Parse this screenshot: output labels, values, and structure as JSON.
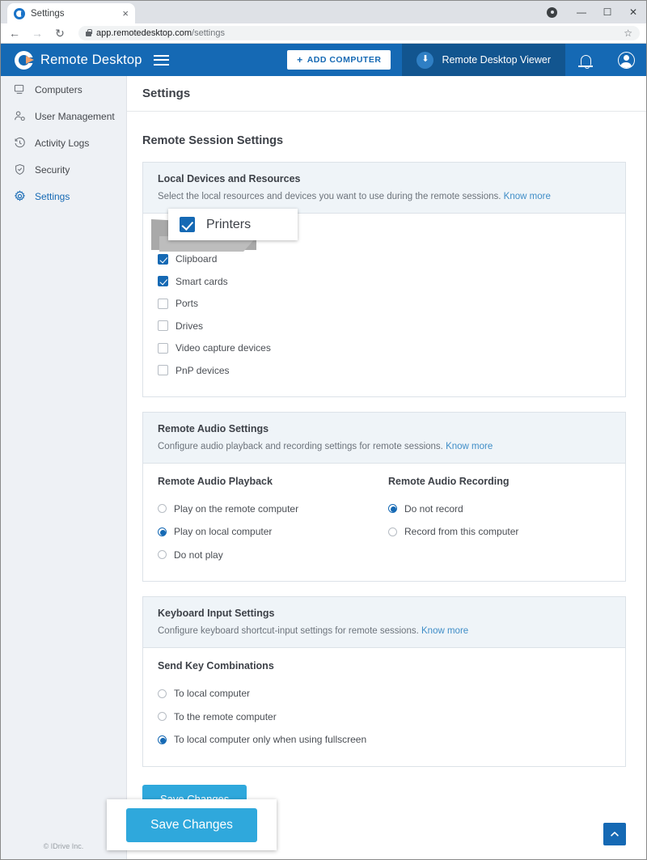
{
  "browser": {
    "tab_title": "Settings",
    "tab_favicon": "remote-desktop-favicon",
    "tab_close": "×",
    "back_icon": "←",
    "forward_icon": "→",
    "reload_icon": "↻",
    "url_host": "app.remotedesktop.com",
    "url_path": "/settings",
    "bookmark_icon": "☆",
    "minimize": "—",
    "maximize": "☐",
    "close": "✕"
  },
  "header": {
    "brand": "Remote Desktop",
    "menu_icon": "hamburger-icon",
    "add_computer": "ADD COMPUTER",
    "add_computer_plus": "+",
    "viewer": "Remote Desktop Viewer",
    "viewer_icon": "download-circle-icon",
    "notifications_icon": "bell-icon",
    "account_icon": "user-avatar-icon",
    "accent": "#1569b4",
    "accent_dark": "#12558f"
  },
  "sidebar": {
    "items": [
      {
        "label": "Computers",
        "icon": "monitor-icon",
        "active": false
      },
      {
        "label": "User Management",
        "icon": "user-gear-icon",
        "active": false
      },
      {
        "label": "Activity Logs",
        "icon": "clock-history-icon",
        "active": false
      },
      {
        "label": "Security",
        "icon": "shield-check-icon",
        "active": false
      },
      {
        "label": "Settings",
        "icon": "gear-icon",
        "active": true
      }
    ],
    "footer": "© IDrive Inc."
  },
  "page": {
    "title": "Settings",
    "section_title": "Remote Session Settings"
  },
  "local_devices": {
    "title": "Local Devices and Resources",
    "description": "Select the local resources and devices you want to use during the remote sessions.",
    "link": "Know more",
    "options": [
      {
        "label": "Printers",
        "checked": true
      },
      {
        "label": "Clipboard",
        "checked": true
      },
      {
        "label": "Smart cards",
        "checked": true
      },
      {
        "label": "Ports",
        "checked": false
      },
      {
        "label": "Drives",
        "checked": false
      },
      {
        "label": "Video capture devices",
        "checked": false
      },
      {
        "label": "PnP devices",
        "checked": false
      }
    ]
  },
  "audio": {
    "title": "Remote Audio Settings",
    "description": "Configure audio playback and recording settings for remote sessions.",
    "link": "Know more",
    "playback": {
      "title": "Remote Audio Playback",
      "options": [
        {
          "label": "Play on the remote computer",
          "selected": false
        },
        {
          "label": "Play on local computer",
          "selected": true
        },
        {
          "label": "Do not play",
          "selected": false
        }
      ]
    },
    "recording": {
      "title": "Remote Audio Recording",
      "options": [
        {
          "label": "Do not record",
          "selected": true
        },
        {
          "label": "Record from this computer",
          "selected": false
        }
      ]
    }
  },
  "keyboard": {
    "title": "Keyboard Input Settings",
    "description": "Configure keyboard shortcut-input settings for remote sessions.",
    "link": "Know more",
    "group_title": "Send Key Combinations",
    "options": [
      {
        "label": "To local computer",
        "selected": false
      },
      {
        "label": "To the remote computer",
        "selected": false
      },
      {
        "label": "To local computer only when using fullscreen",
        "selected": true
      }
    ]
  },
  "actions": {
    "save": "Save Changes",
    "save_color": "#2fa8dc",
    "scroll_top_icon": "chevron-up-icon"
  },
  "callouts": {
    "printers_zoom_label": "Printers",
    "save_zoom_label": "Save Changes"
  }
}
